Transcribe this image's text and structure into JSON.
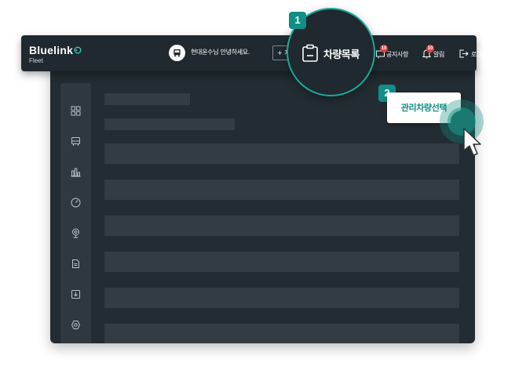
{
  "header": {
    "logo_name": "Bluelink",
    "logo_sub": "Fleet",
    "greeting": "현대윤수님 안녕하세요.",
    "add_button": "+ 차",
    "notice_label": "공지사항",
    "notice_badge": "10",
    "alarm_label": "알림",
    "alarm_badge": "10",
    "logout_label": "로그아웃"
  },
  "callout_1": {
    "step": "1",
    "label": "차량목록"
  },
  "callout_2": {
    "step": "2",
    "label": "관리차량선택"
  },
  "sidebar": {
    "icons": [
      "dashboard-icon",
      "bus-icon",
      "bar-chart-icon",
      "gauge-icon",
      "location-icon",
      "document-icon",
      "download-icon",
      "settings-icon"
    ]
  },
  "colors": {
    "accent": "#0f8f85",
    "header_bg": "#1f292f",
    "body_bg": "#222c32",
    "skeleton": "#323c42",
    "badge": "#e8413a"
  }
}
